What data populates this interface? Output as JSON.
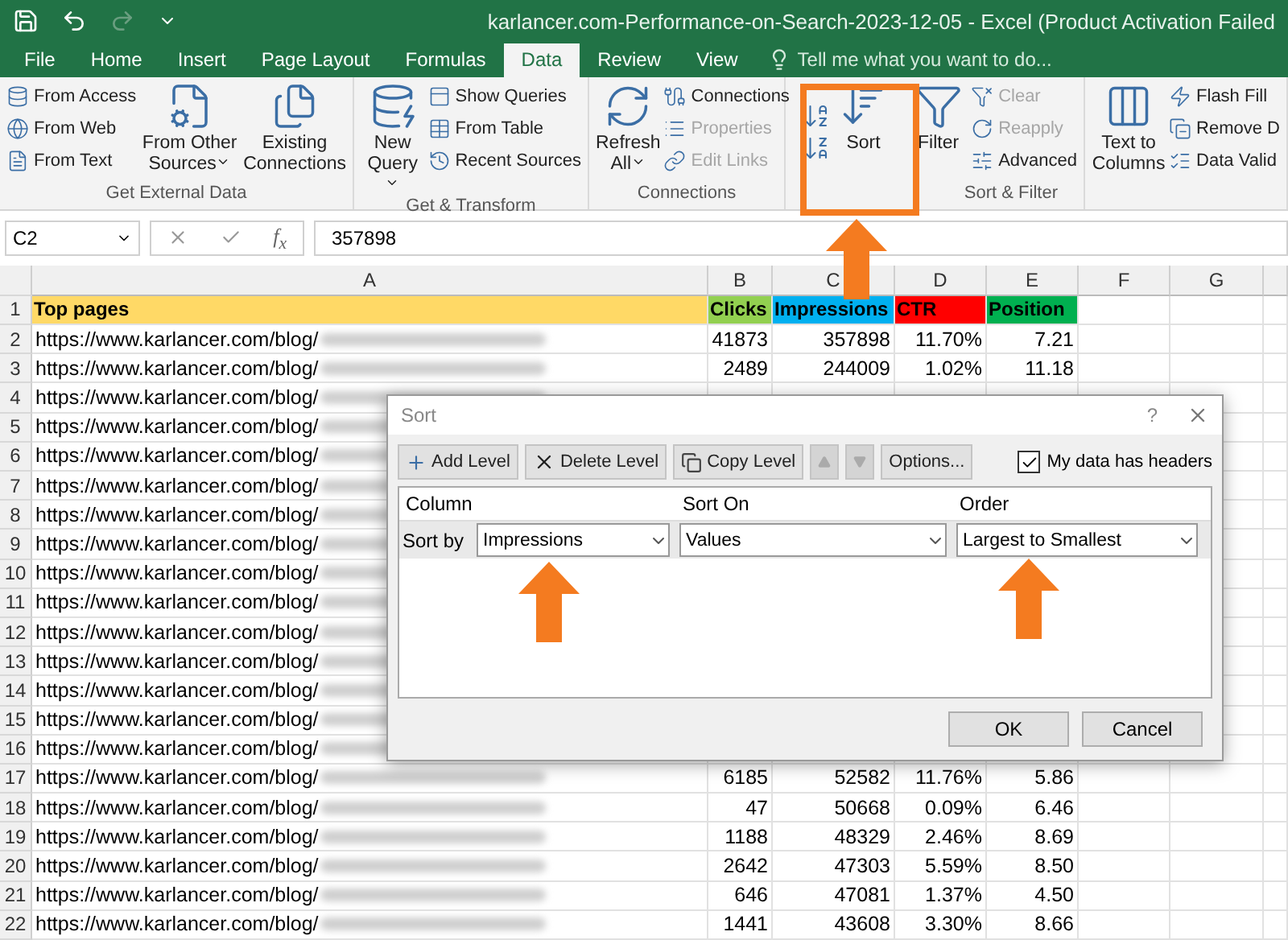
{
  "window": {
    "title": "karlancer.com-Performance-on-Search-2023-12-05 - Excel (Product Activation Failed"
  },
  "tabs": [
    {
      "label": "File",
      "selected": false
    },
    {
      "label": "Home",
      "selected": false
    },
    {
      "label": "Insert",
      "selected": false
    },
    {
      "label": "Page Layout",
      "selected": false
    },
    {
      "label": "Formulas",
      "selected": false
    },
    {
      "label": "Data",
      "selected": true
    },
    {
      "label": "Review",
      "selected": false
    },
    {
      "label": "View",
      "selected": false
    }
  ],
  "tell_me": {
    "placeholder": "Tell me what you want to do..."
  },
  "ribbon": {
    "groups": [
      {
        "kind": "standard",
        "label": "Get External Data",
        "items": [
          {
            "kind": "small",
            "label": "From Access"
          },
          {
            "kind": "small",
            "label": "From Web"
          },
          {
            "kind": "small",
            "label": "From Text"
          },
          {
            "kind": "large",
            "label": "From Other Sources",
            "dropdown": true
          },
          {
            "kind": "large",
            "label": "Existing Connections"
          }
        ]
      },
      {
        "kind": "standard",
        "label": "Get & Transform",
        "items": [
          {
            "kind": "large",
            "label": "New Query",
            "dropdown": true
          },
          {
            "kind": "small",
            "label": "Show Queries"
          },
          {
            "kind": "small",
            "label": "From Table"
          },
          {
            "kind": "small",
            "label": "Recent Sources"
          }
        ]
      },
      {
        "kind": "standard",
        "label": "Connections",
        "items": [
          {
            "kind": "large",
            "label": "Refresh All",
            "dropdown": true
          },
          {
            "kind": "small",
            "label": "Connections"
          },
          {
            "kind": "small",
            "label": "Properties",
            "disabled": true
          },
          {
            "kind": "small",
            "label": "Edit Links",
            "disabled": true
          }
        ]
      },
      {
        "kind": "sort",
        "label": "Sort & Filter",
        "items": [
          {
            "kind": "large",
            "label": "Sort"
          },
          {
            "kind": "large",
            "label": "Filter"
          },
          {
            "kind": "small",
            "label": "Clear",
            "disabled": true
          },
          {
            "kind": "small",
            "label": "Reapply",
            "disabled": true
          },
          {
            "kind": "small",
            "label": "Advanced"
          }
        ]
      },
      {
        "kind": "standard",
        "items": [
          {
            "kind": "large",
            "label": "Text to Columns"
          },
          {
            "kind": "small",
            "label": "Flash Fill"
          },
          {
            "kind": "small",
            "label": "Remove D"
          },
          {
            "kind": "small",
            "label": "Data Valid"
          }
        ]
      }
    ]
  },
  "formula_bar": {
    "name_box": "C2",
    "function_label": "f$_{x}$",
    "formula": "357898"
  },
  "sheet": {
    "columns": [
      "A",
      "B",
      "C",
      "D",
      "E",
      "F",
      "G"
    ],
    "rows": [
      {
        "number": "1",
        "kind": "header",
        "cells": [
          {
            "text": "Top pages",
            "color": "#ffd966"
          },
          {
            "text": "Clicks",
            "color": "#92d050"
          },
          {
            "text": "Impressions",
            "color": "#00b0f0"
          },
          {
            "text": "CTR",
            "color": "#ff0000"
          },
          {
            "text": "Position",
            "color": "#00b050"
          }
        ]
      },
      {
        "number": "2",
        "kind": "data",
        "url": "https://www.karlancer.com/blog/",
        "values": [
          "41873",
          "357898",
          "11.70%",
          "7.21"
        ]
      },
      {
        "number": "3",
        "kind": "data",
        "url": "https://www.karlancer.com/blog/",
        "values": [
          "2489",
          "244009",
          "1.02%",
          "11.18"
        ]
      },
      {
        "number": "4",
        "kind": "data",
        "url": "https://www.karlancer.com/blog/"
      },
      {
        "number": "5",
        "kind": "data",
        "url": "https://www.karlancer.com/blog/"
      },
      {
        "number": "6",
        "kind": "data",
        "url": "https://www.karlancer.com/blog/"
      },
      {
        "number": "7",
        "kind": "data",
        "url": "https://www.karlancer.com/blog/"
      },
      {
        "number": "8",
        "kind": "data",
        "url": "https://www.karlancer.com/blog/"
      },
      {
        "number": "9",
        "kind": "data",
        "url": "https://www.karlancer.com/blog/"
      },
      {
        "number": "10",
        "kind": "data",
        "url": "https://www.karlancer.com/blog/"
      },
      {
        "number": "11",
        "kind": "data",
        "url": "https://www.karlancer.com/blog/"
      },
      {
        "number": "12",
        "kind": "data",
        "url": "https://www.karlancer.com/blog/"
      },
      {
        "number": "13",
        "kind": "data",
        "url": "https://www.karlancer.com/blog/"
      },
      {
        "number": "14",
        "kind": "data",
        "url": "https://www.karlancer.com/blog/"
      },
      {
        "number": "15",
        "kind": "data",
        "url": "https://www.karlancer.com/blog/"
      },
      {
        "number": "16",
        "kind": "data",
        "url": "https://www.karlancer.com/blog/"
      },
      {
        "number": "17",
        "kind": "data",
        "url": "https://www.karlancer.com/blog/",
        "values": [
          "6185",
          "52582",
          "11.76%",
          "5.86"
        ]
      },
      {
        "number": "18",
        "kind": "data",
        "url": "https://www.karlancer.com/blog/",
        "values": [
          "47",
          "50668",
          "0.09%",
          "6.46"
        ]
      },
      {
        "number": "19",
        "kind": "data",
        "url": "https://www.karlancer.com/blog/",
        "values": [
          "1188",
          "48329",
          "2.46%",
          "8.69"
        ]
      },
      {
        "number": "20",
        "kind": "data",
        "url": "https://www.karlancer.com/blog/",
        "values": [
          "2642",
          "47303",
          "5.59%",
          "8.50"
        ]
      },
      {
        "number": "21",
        "kind": "data",
        "url": "https://www.karlancer.com/blog/",
        "values": [
          "646",
          "47081",
          "1.37%",
          "4.50"
        ]
      },
      {
        "number": "22",
        "kind": "data",
        "url": "https://www.karlancer.com/blog/",
        "values": [
          "1441",
          "43608",
          "3.30%",
          "8.66"
        ]
      }
    ]
  },
  "sort_dialog": {
    "title": "Sort",
    "help": "?",
    "toolbar": [
      {
        "kind": "add",
        "label": "Add Level"
      },
      {
        "kind": "delete",
        "label": "Delete Level"
      },
      {
        "kind": "copy",
        "label": "Copy Level"
      },
      {
        "kind": "up",
        "disabled": true
      },
      {
        "kind": "down",
        "disabled": true
      },
      {
        "kind": "text",
        "label": "Options..."
      }
    ],
    "headers_checkbox": {
      "label": "My data has headers",
      "checked": true
    },
    "columns": [
      "Column",
      "Sort On",
      "Order"
    ],
    "levels": [
      {
        "label": "Sort by",
        "column": "Impressions",
        "sort_on": "Values",
        "order": "Largest to Smallest"
      }
    ],
    "buttons": [
      "OK",
      "Cancel"
    ]
  }
}
